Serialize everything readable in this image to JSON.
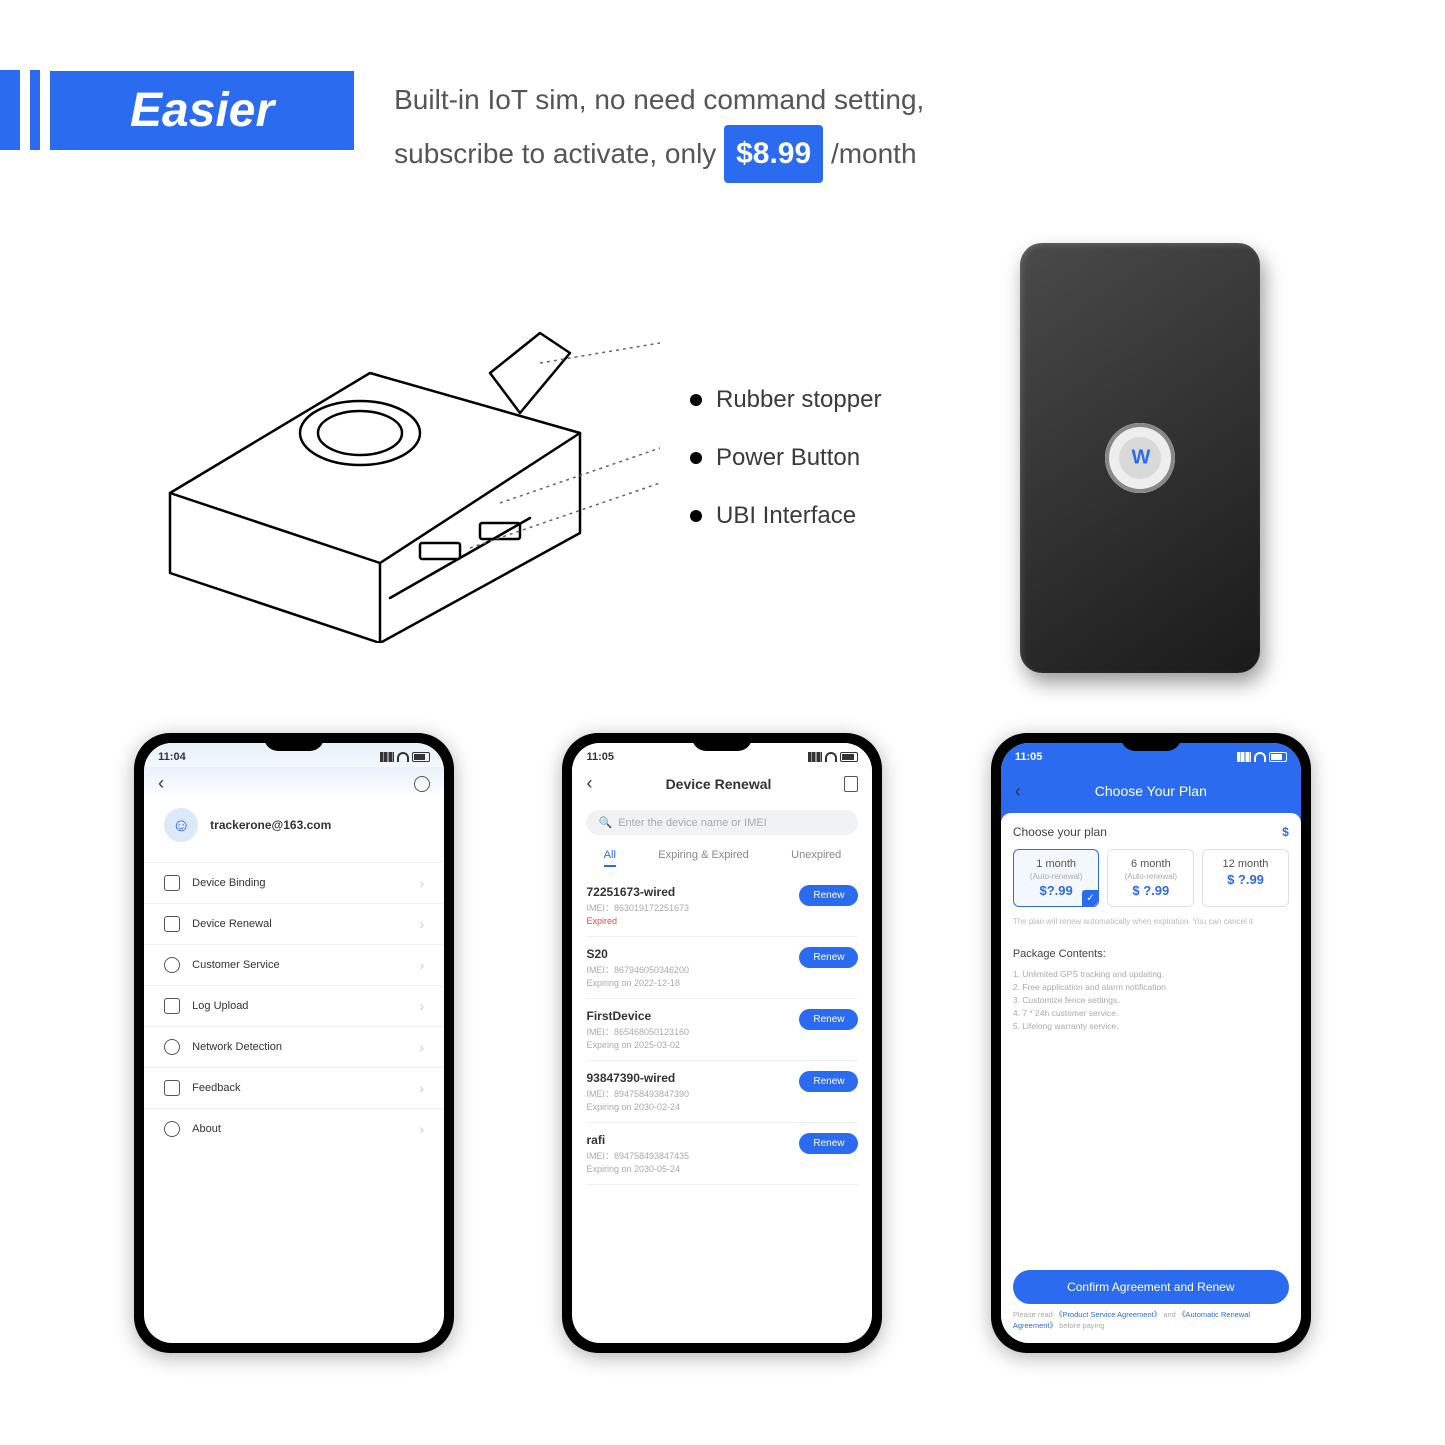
{
  "header": {
    "title": "Easier",
    "desc_line1": "Built-in IoT sim, no need command setting,",
    "desc_line2_a": "subscribe to activate, only",
    "price": "$8.99",
    "desc_line2_b": "/month"
  },
  "callouts": {
    "rubber": "Rubber stopper",
    "power": "Power Button",
    "ubi": "UBI Interface"
  },
  "device_logo": "W",
  "phones": {
    "p1": {
      "time": "11:04",
      "email": "trackerone@163.com",
      "menu": [
        "Device Binding",
        "Device Renewal",
        "Customer Service",
        "Log Upload",
        "Network Detection",
        "Feedback",
        "About"
      ]
    },
    "p2": {
      "time": "11:05",
      "title": "Device Renewal",
      "search_placeholder": "Enter the device name or IMEI",
      "tabs": {
        "all": "All",
        "exp": "Expiring & Expired",
        "unexp": "Unexpired"
      },
      "devices": [
        {
          "name": "72251673-wired",
          "imei": "IMEI：863019172251673",
          "extra": "Expired",
          "expired": true
        },
        {
          "name": "S20",
          "imei": "IMEI：867946050346200",
          "extra": "Expiring on 2022-12-18"
        },
        {
          "name": "FirstDevice",
          "imei": "IMEI：865468050123160",
          "extra": "Expiring on 2025-03-02"
        },
        {
          "name": "93847390-wired",
          "imei": "IMEI：894758493847390",
          "extra": "Expiring on 2030-02-24"
        },
        {
          "name": "rafi",
          "imei": "IMEI：894758493847435",
          "extra": "Expiring on 2030-05-24"
        }
      ],
      "renew_label": "Renew"
    },
    "p3": {
      "time": "11:05",
      "title": "Choose Your Plan",
      "choose": "Choose your plan",
      "currency": "$",
      "plans": [
        {
          "dur": "1 month",
          "sub": "(Auto-renewal)",
          "price": "$?.99"
        },
        {
          "dur": "6 month",
          "sub": "(Auto-renewal)",
          "price": "$ ?.99"
        },
        {
          "dur": "12 month",
          "sub": "",
          "price": "$ ?.99"
        }
      ],
      "note": "The plan will renew automatically when expiration. You can cancel it",
      "pkg_title": "Package Contents:",
      "pkg": [
        "1. Unlimited GPS tracking and updating.",
        "2. Free application and alarm notification.",
        "3. Customize fence settings.",
        "4. 7 * 24h customer service.",
        "5. Lifelong warranty service."
      ],
      "confirm": "Confirm Agreement and Renew",
      "agree_a": "Please read",
      "agree_link1": "《Product Service Agreement》",
      "agree_b": "and",
      "agree_link2": "《Automatic Renewal Agreement》",
      "agree_c": "before paying"
    }
  }
}
